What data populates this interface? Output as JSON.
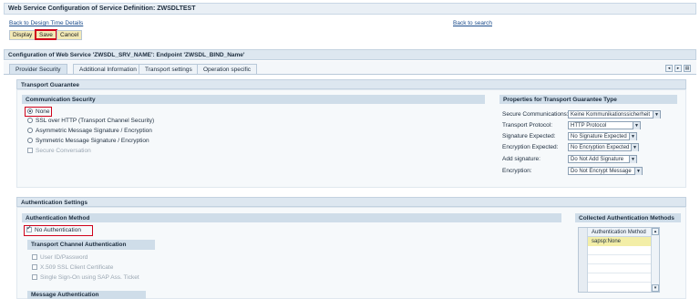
{
  "header": {
    "title": "Web Service Configuration of Service Definition: ZWSDLTEST"
  },
  "links": {
    "back_design": "Back to Design Time Details",
    "back_search": "Back to search"
  },
  "toolbar": {
    "display": "Display",
    "save": "Save",
    "cancel": "Cancel"
  },
  "config_title": "Configuration of Web Service 'ZWSDL_SRV_NAME': Endpoint 'ZWSDL_BIND_Name'",
  "tabs": [
    "Provider Security",
    "Additional Information",
    "Transport settings",
    "Operation specific"
  ],
  "transport": {
    "title": "Transport Guarantee",
    "comm_security": "Communication Security",
    "options": [
      "None",
      "SSL over HTTP (Transport Channel Security)",
      "Asymmetric Message Signature / Encryption",
      "Symmetric Message Signature / Encryption"
    ],
    "secure_conversation": "Secure Conversation",
    "properties_title": "Properties for Transport Guarantee Type",
    "properties": [
      {
        "label": "Secure Communications:",
        "value": "Keine Kommunikationssicherheit"
      },
      {
        "label": "Transport Protocol:",
        "value": "HTTP Protocol"
      },
      {
        "label": "Signature Expected:",
        "value": "No Signature Expected"
      },
      {
        "label": "Encryption Expected:",
        "value": "No Encryption Expected"
      },
      {
        "label": "Add signature:",
        "value": "Do Not Add Signature"
      },
      {
        "label": "Encryption:",
        "value": "Do Not Encrypt Message"
      }
    ]
  },
  "auth": {
    "title": "Authentication Settings",
    "method_title": "Authentication Method",
    "no_auth": "No Authentication",
    "transport_channel": "Transport Channel Authentication",
    "transport_options": [
      "User ID/Password",
      "X.509 SSL Client Certificate",
      "Single Sign-On using SAP Ass. Ticket"
    ],
    "message_auth": "Message Authentication",
    "collected_title": "Collected Authentication Methods",
    "collected_header": "Authentication Method",
    "collected_rows": [
      "sapsp:None"
    ]
  }
}
